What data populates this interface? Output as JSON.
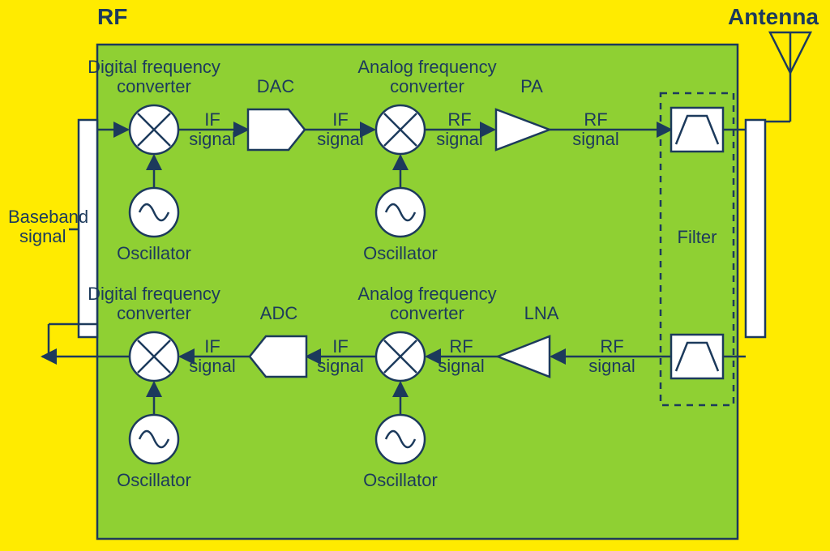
{
  "header": {
    "rf": "RF",
    "antenna": "Antenna"
  },
  "baseband": {
    "l1": "Baseband",
    "l2": "signal"
  },
  "filter": "Filter",
  "tx": {
    "dfc": {
      "l1": "Digital frequency",
      "l2": "converter"
    },
    "afc": {
      "l1": "Analog frequency",
      "l2": "converter"
    },
    "dac": "DAC",
    "pa": "PA",
    "osc": "Oscillator",
    "if_l1": "IF",
    "if_l2": "signal",
    "rf_l1": "RF",
    "rf_l2": "signal"
  },
  "rx": {
    "dfc": {
      "l1": "Digital frequency",
      "l2": "converter"
    },
    "afc": {
      "l1": "Analog frequency",
      "l2": "converter"
    },
    "adc": "ADC",
    "lna": "LNA",
    "osc": "Oscillator",
    "if_l1": "IF",
    "if_l2": "signal",
    "rf_l1": "RF",
    "rf_l2": "signal"
  }
}
